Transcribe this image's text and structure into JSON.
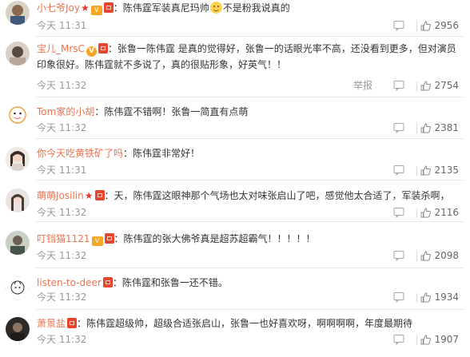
{
  "colors": {
    "username": "#eb7350",
    "meta": "#999999",
    "text": "#333333",
    "divider": "#e6e6e6"
  },
  "comments": [
    {
      "user": "小七爷Joy",
      "body": "：陈伟霆军装真尼玛帅",
      "body_after_emoji": "不是粉我说真的",
      "time": "今天 11:31",
      "likes": "2956"
    },
    {
      "user": "宝儿_MrsC",
      "body": "：张鲁一陈伟霆 是真的觉得好，张鲁一的话眼光率不高，还没看到更多，但对演员印象很好。陈伟霆就不多说了，真的很贴形象，好英气！！",
      "time": "今天 11:32",
      "report": "举报",
      "likes": "2754"
    },
    {
      "user": "Tom家的小胡",
      "body": "：陈伟霆不错啊！张鲁一简直有点萌",
      "time": "今天 11:32",
      "likes": "2381"
    },
    {
      "user": "你今天吃黄铁矿了吗",
      "body": "：陈伟霆非常好！",
      "time": "今天 11:31",
      "likes": "2135"
    },
    {
      "user": "萌萌Josilin",
      "body": "：天，陈伟霆这眼神那个气场也太对味张启山了吧，感觉他太合适了，军装杀啊，",
      "time": "今天 11:32",
      "likes": "2116"
    },
    {
      "user": "叮铛猫1121",
      "body": "：陈伟霆的张大佛爷真是超苏超霸气！！！！！",
      "time": "今天 11:32",
      "likes": "2098"
    },
    {
      "user": "listen-to-deer",
      "body": "：陈伟霆和张鲁一还不错。",
      "time": "今天 11:32",
      "likes": "1934"
    },
    {
      "user": "萧景盐",
      "body": "：陈伟霆超级帅，超级合适张启山，张鲁一也好喜欢呀，啊啊啊啊，年度最期待",
      "time": "今天 11:32",
      "likes": "1907"
    }
  ]
}
